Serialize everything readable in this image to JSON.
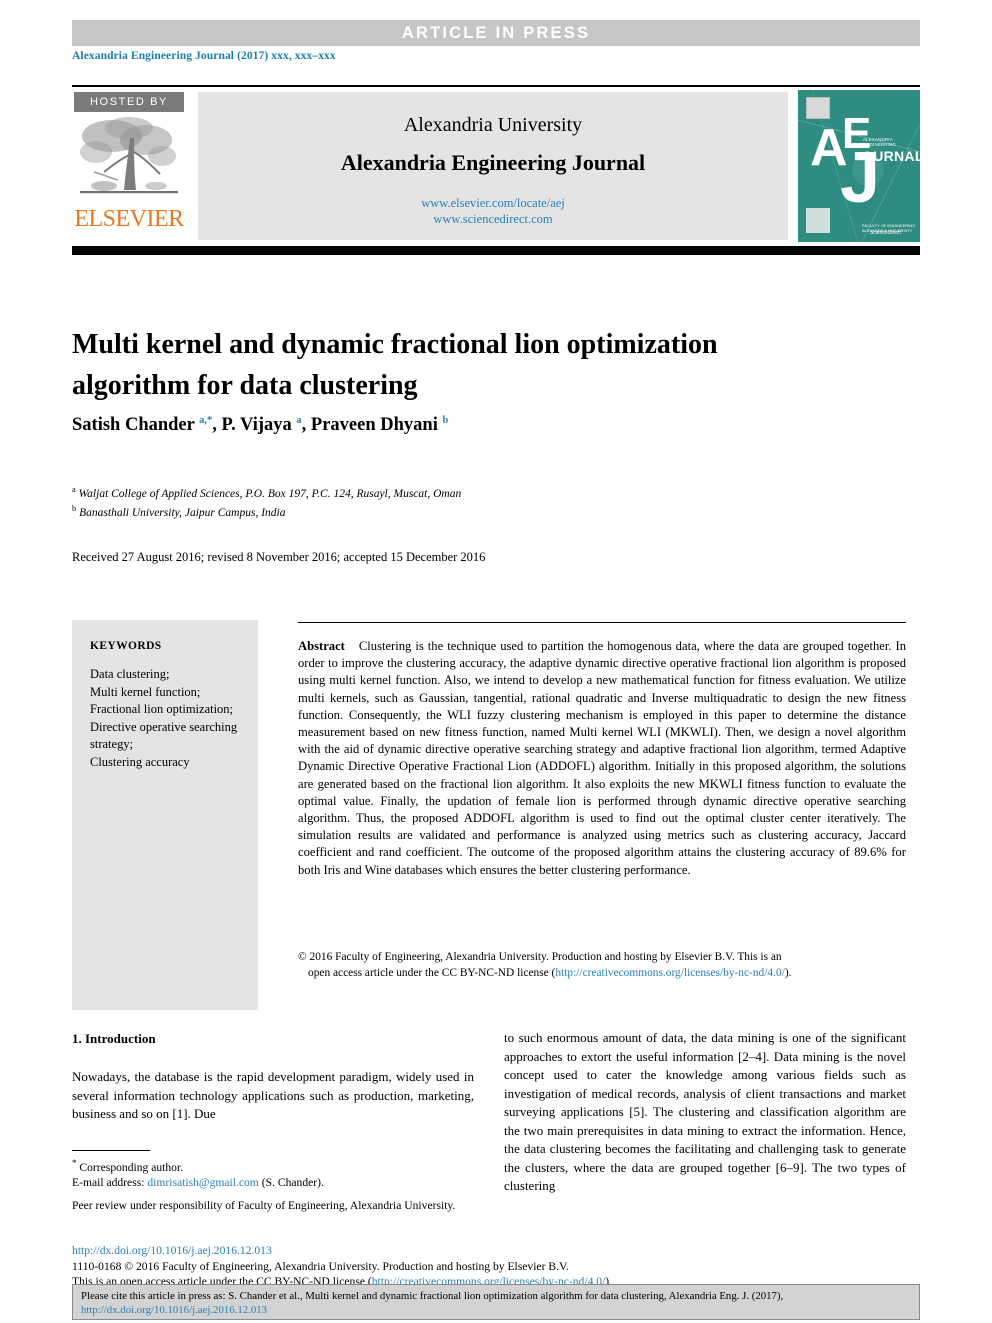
{
  "banner": {
    "article_in_press": "ARTICLE  IN  PRESS",
    "journal_ref": "Alexandria Engineering Journal (2017) xxx, xxx–xxx"
  },
  "masthead": {
    "hosted_by": "HOSTED BY",
    "publisher": "ELSEVIER",
    "university": "Alexandria University",
    "journal_name": "Alexandria Engineering Journal",
    "link_locate": "www.elsevier.com/locate/aej",
    "link_sciencedirect": "www.sciencedirect.com",
    "cover": {
      "letter_a": "A",
      "letter_e": "E",
      "letter_j": "J",
      "journal_word": "OURNAL",
      "tiny_title": "ALEXANDRIA ENGINEERING",
      "footline": "FACULTY OF ENGINEERING ALEXANDRIA UNIVERSITY",
      "foot2": "ScienceDirect"
    },
    "teal": "#2e8c80",
    "elsevier_orange": "#E87722",
    "link_blue": "#2a7fb8"
  },
  "article": {
    "title": "Multi kernel and dynamic fractional lion optimization algorithm for data clustering",
    "authors_html": "Satish Chander <sup>a,*</sup>, P. Vijaya <sup>a</sup>, Praveen Dhyani <sup>b</sup>",
    "affiliation_a": "Waljat College of Applied Sciences, P.O. Box 197, P.C. 124, Rusayl, Muscat, Oman",
    "affiliation_b": "Banasthali University, Jaipur Campus, India",
    "dates": "Received 27 August 2016; revised 8 November 2016; accepted 15 December 2016"
  },
  "keywords": {
    "heading": "KEYWORDS",
    "items_text": "Data clustering;\nMulti kernel function;\nFractional lion optimization;\nDirective operative searching strategy;\nClustering accuracy",
    "items": [
      "Data clustering;",
      "Multi kernel function;",
      "Fractional lion optimization;",
      "Directive operative searching strategy;",
      "Clustering accuracy"
    ]
  },
  "abstract": {
    "label": "Abstract",
    "body": "Clustering is the technique used to partition the homogenous data, where the data are grouped together. In order to improve the clustering accuracy, the adaptive dynamic directive operative fractional lion algorithm is proposed using multi kernel function. Also, we intend to develop a new mathematical function for fitness evaluation. We utilize multi kernels, such as Gaussian, tangential, rational quadratic and Inverse multiquadratic to design the new fitness function. Consequently, the WLI fuzzy clustering mechanism is employed in this paper to determine the distance measurement based on new fitness function, named Multi kernel WLI (MKWLI). Then, we design a novel algorithm with the aid of dynamic directive operative searching strategy and adaptive fractional lion algorithm, termed Adaptive Dynamic Directive Operative Fractional Lion (ADDOFL) algorithm. Initially in this proposed algorithm, the solutions are generated based on the fractional lion algorithm. It also exploits the new MKWLI fitness function to evaluate the optimal value. Finally, the updation of female lion is performed through dynamic directive operative searching algorithm. Thus, the proposed ADDOFL algorithm is used to find out the optimal cluster center iteratively. The simulation results are validated and performance is analyzed using metrics such as clustering accuracy, Jaccard coefficient and rand coefficient. The outcome of the proposed algorithm attains the clustering accuracy of 89.6% for both Iris and Wine databases which ensures the better clustering performance.",
    "copyright_line1": "© 2016 Faculty of Engineering, Alexandria University. Production and hosting by Elsevier B.V. This is an",
    "copyright_line2_pre": "open access article under the CC BY-NC-ND license (",
    "copyright_license_url": "http://creativecommons.org/licenses/by-nc-nd/4.0/",
    "copyright_line2_post": ")."
  },
  "body": {
    "section_heading": "1. Introduction",
    "left_paragraph": "Nowadays, the database is the rapid development paradigm, widely used in several information technology applications such as production, marketing, business and so on [1]. Due",
    "right_paragraph": "to such enormous amount of data, the data mining is one of the significant approaches to extort the useful information [2–4]. Data mining is the novel concept used to cater the knowledge among various fields such as investigation of medical records, analysis of client transactions and market surveying applications [5]. The clustering and classification algorithm are the two main prerequisites in data mining to extract the information. Hence, the data clustering becomes the facilitating and challenging task to generate the clusters, where the data are grouped together [6–9]. The two types of clustering"
  },
  "footnotes": {
    "corresponding": "Corresponding author.",
    "email_label": "E-mail address:",
    "email": "dimrisatish@gmail.com",
    "email_suffix": "(S. Chander).",
    "peer_review": "Peer review under responsibility of Faculty of Engineering, Alexandria University.",
    "doi": "http://dx.doi.org/10.1016/j.aej.2016.12.013",
    "issn_line": "1110-0168 © 2016 Faculty of Engineering, Alexandria University. Production and hosting by Elsevier B.V.",
    "license_pre": "This is an open access article under the CC BY-NC-ND license (",
    "license_url": "http://creativecommons.org/licenses/by-nc-nd/4.0/",
    "license_post": ")."
  },
  "cite_box": {
    "text": "Please cite this article in press as: S. Chander et al., Multi kernel and dynamic fractional lion optimization algorithm for data clustering,  Alexandria Eng. J. (2017),",
    "url": "http://dx.doi.org/10.1016/j.aej.2016.12.013"
  }
}
